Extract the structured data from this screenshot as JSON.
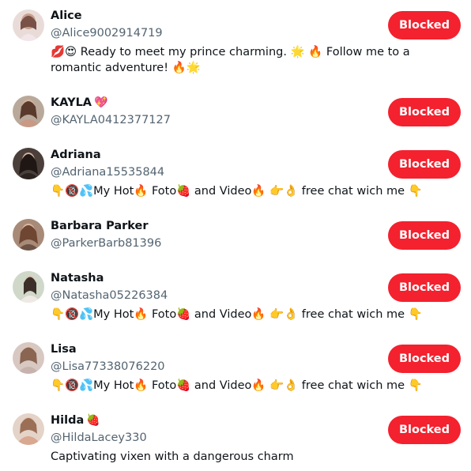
{
  "colors": {
    "blocked_button_bg": "#f4212e",
    "handle_text": "#536471",
    "primary_text": "#0f1419"
  },
  "users": [
    {
      "name": "Alice",
      "name_badge": "",
      "handle": "@Alice9002914719",
      "bio": "💋😍 Ready to meet my prince charming. 🌟 🔥 Follow me to a romantic adventure! 🔥🌟",
      "button_label": "Blocked"
    },
    {
      "name": "KAYLA",
      "name_badge": "💖",
      "handle": "@KAYLA0412377127",
      "bio": "",
      "button_label": "Blocked"
    },
    {
      "name": "Adriana",
      "name_badge": "",
      "handle": "@Adriana15535844",
      "bio": "👇🔞💦My Hot🔥 Foto🍓 and Video🔥 👉👌 free chat wich me 👇",
      "button_label": "Blocked"
    },
    {
      "name": "Barbara Parker",
      "name_badge": "",
      "handle": "@ParkerBarb81396",
      "bio": "",
      "button_label": "Blocked"
    },
    {
      "name": "Natasha",
      "name_badge": "",
      "handle": "@Natasha05226384",
      "bio": "👇🔞💦My Hot🔥 Foto🍓 and Video🔥 👉👌 free chat wich me 👇",
      "button_label": "Blocked"
    },
    {
      "name": "Lisa",
      "name_badge": "",
      "handle": "@Lisa77338076220",
      "bio": "👇🔞💦My Hot🔥 Foto🍓 and Video🔥 👉👌 free chat wich me 👇",
      "button_label": "Blocked"
    },
    {
      "name": "Hilda",
      "name_badge": "🍓",
      "handle": "@HildaLacey330",
      "bio": "Captivating vixen with a dangerous charm",
      "button_label": "Blocked"
    }
  ]
}
